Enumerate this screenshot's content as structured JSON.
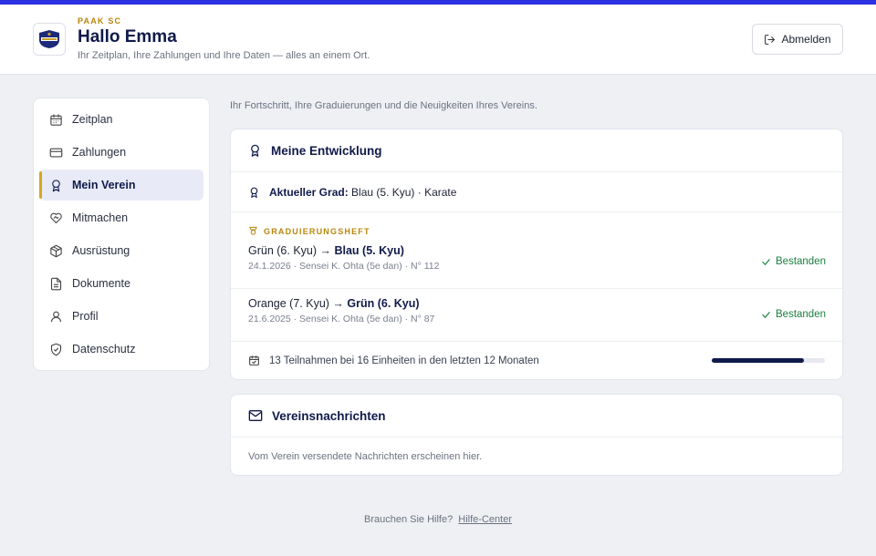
{
  "header": {
    "club_name": "PAAK SC",
    "greeting": "Hallo Emma",
    "subtitle": "Ihr Zeitplan, Ihre Zahlungen und Ihre Daten — alles an einem Ort.",
    "logout_label": "Abmelden"
  },
  "sidebar": {
    "items": [
      {
        "label": "Zeitplan",
        "icon": "calendar-icon"
      },
      {
        "label": "Zahlungen",
        "icon": "credit-card-icon"
      },
      {
        "label": "Mein Verein",
        "icon": "award-icon",
        "active": true
      },
      {
        "label": "Mitmachen",
        "icon": "heart-handshake-icon"
      },
      {
        "label": "Ausrüstung",
        "icon": "package-icon"
      },
      {
        "label": "Dokumente",
        "icon": "document-icon"
      },
      {
        "label": "Profil",
        "icon": "user-icon"
      },
      {
        "label": "Datenschutz",
        "icon": "shield-check-icon"
      }
    ]
  },
  "main": {
    "intro": "Ihr Fortschritt, Ihre Graduierungen und die Neuigkeiten Ihres Vereins.",
    "development": {
      "title": "Meine Entwicklung",
      "current_grade_label": "Aktueller Grad:",
      "current_grade_value": "Blau (5. Kyu) · Karate",
      "section_label": "GRADUIERUNGSHEFT",
      "entries": [
        {
          "from": "Grün (6. Kyu) →",
          "to": "Blau (5. Kyu)",
          "meta": "24.1.2026 · Sensei K. Ohta (5e dan) · N° 112",
          "status": "Bestanden"
        },
        {
          "from": "Orange (7. Kyu) →",
          "to": "Grün (6. Kyu)",
          "meta": "21.6.2025 · Sensei K. Ohta (5e dan) · N° 87",
          "status": "Bestanden"
        }
      ],
      "attendance_text": "13 Teilnahmen bei 16 Einheiten in den letzten 12 Monaten",
      "attendance_ratio": 0.8125
    },
    "news": {
      "title": "Vereinsnachrichten",
      "empty_text": "Vom Verein versendete Nachrichten erscheinen hier."
    }
  },
  "footer": {
    "help_text": "Brauchen Sie Hilfe?",
    "help_link": "Hilfe-Center"
  },
  "colors": {
    "accent": "#2b31e0",
    "navy": "#0f1a4a",
    "gold": "#b8860b",
    "success": "#1a7f3e"
  }
}
